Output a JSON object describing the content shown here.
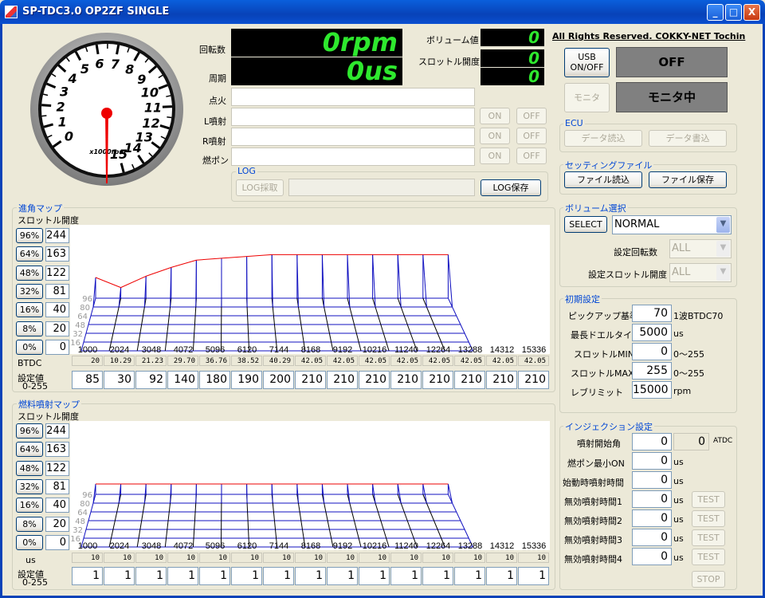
{
  "window": {
    "title": "SP-TDC3.0 OP2ZF SINGLE",
    "min": "_",
    "max": "□",
    "close": "X"
  },
  "copyright": "All Rights Reserved. COKKY-NET Tochin",
  "gauge": {
    "unit_label": "x1000rpm",
    "ticks": [
      "0",
      "1",
      "2",
      "3",
      "4",
      "5",
      "6",
      "7",
      "8",
      "9",
      "10",
      "11",
      "12",
      "13",
      "14",
      "15"
    ]
  },
  "readout": {
    "rpm_label": "回転数",
    "rpm_value": "0rpm",
    "period_label": "周期",
    "period_value": "0us",
    "volume_label": "ボリューム値",
    "volume_value": "0",
    "throttle_label": "スロットル開度",
    "throttle_value": "0",
    "throttle_value2": "0"
  },
  "status_rows": [
    {
      "label": "点火",
      "value": "",
      "has_buttons": false
    },
    {
      "label": "L噴射",
      "value": "",
      "has_buttons": true,
      "on": "ON",
      "off": "OFF"
    },
    {
      "label": "R噴射",
      "value": "",
      "has_buttons": true,
      "on": "ON",
      "off": "OFF"
    },
    {
      "label": "燃ポン",
      "value": "",
      "has_buttons": true,
      "on": "ON",
      "off": "OFF"
    }
  ],
  "log": {
    "title": "LOG",
    "capture": "LOG採取",
    "path": "",
    "save": "LOG保存"
  },
  "usb": {
    "button": "USB\nON/OFF",
    "status": "OFF"
  },
  "monitor": {
    "button": "モニタ",
    "status": "モニタ中"
  },
  "ecu": {
    "title": "ECU",
    "read": "データ読込",
    "write": "データ書込"
  },
  "settings_file": {
    "title": "セッティングファイル",
    "read": "ファイル読込",
    "save": "ファイル保存"
  },
  "volume_select": {
    "title": "ボリューム選択",
    "select_btn": "SELECT",
    "selected": "NORMAL",
    "rpm_label": "設定回転数",
    "rpm_value": "ALL",
    "thr_label": "設定スロットル開度",
    "thr_value": "ALL"
  },
  "init": {
    "title": "初期設定",
    "rows": [
      {
        "label": "ピックアップ基準",
        "value": "70",
        "unit": "1波BTDC70"
      },
      {
        "label": "最長ドエルタイム",
        "value": "5000",
        "unit": "us"
      },
      {
        "label": "スロットルMIN",
        "value": "0",
        "unit": "0～255"
      },
      {
        "label": "スロットルMAX",
        "value": "255",
        "unit": "0～255"
      },
      {
        "label": "レブリミット",
        "value": "15000",
        "unit": "rpm"
      }
    ]
  },
  "injection": {
    "title": "インジェクション設定",
    "start_label": "噴射開始角",
    "start_value": "0",
    "start_value2": "0",
    "start_unit": "ATDC",
    "rows": [
      {
        "label": "燃ポン最小ON",
        "value": "0",
        "unit": "us",
        "test": ""
      },
      {
        "label": "始動時噴射時間",
        "value": "0",
        "unit": "us",
        "test": ""
      },
      {
        "label": "無効噴射時間1",
        "value": "0",
        "unit": "us",
        "test": "TEST"
      },
      {
        "label": "無効噴射時間2",
        "value": "0",
        "unit": "us",
        "test": "TEST"
      },
      {
        "label": "無効噴射時間3",
        "value": "0",
        "unit": "us",
        "test": "TEST"
      },
      {
        "label": "無効噴射時間4",
        "value": "0",
        "unit": "us",
        "test": "TEST"
      }
    ],
    "stop": "STOP"
  },
  "advance_map": {
    "title": "進角マップ",
    "subtitle": "スロットル開度",
    "throttle_rows": [
      {
        "pct": "96%",
        "val": "244"
      },
      {
        "pct": "64%",
        "val": "163"
      },
      {
        "pct": "48%",
        "val": "122"
      },
      {
        "pct": "32%",
        "val": "81"
      },
      {
        "pct": "16%",
        "val": "40"
      },
      {
        "pct": "8%",
        "val": "20"
      },
      {
        "pct": "0%",
        "val": "0"
      }
    ],
    "depth_labels": [
      "96",
      "80",
      "64",
      "48",
      "32",
      "16"
    ],
    "row_label": "BTDC",
    "setting_label": "設定値",
    "setting_range": "0-255",
    "btdc": [
      "20",
      "10.29",
      "21.23",
      "29.70",
      "36.76",
      "38.52",
      "40.29",
      "42.05",
      "42.05",
      "42.05",
      "42.05",
      "42.05",
      "42.05",
      "42.05",
      "42.05"
    ],
    "settings": [
      "85",
      "30",
      "92",
      "140",
      "180",
      "190",
      "200",
      "210",
      "210",
      "210",
      "210",
      "210",
      "210",
      "210",
      "210"
    ]
  },
  "fuel_map": {
    "title": "燃料噴射マップ",
    "subtitle": "スロットル開度",
    "throttle_rows": [
      {
        "pct": "96%",
        "val": "244"
      },
      {
        "pct": "64%",
        "val": "163"
      },
      {
        "pct": "48%",
        "val": "122"
      },
      {
        "pct": "32%",
        "val": "81"
      },
      {
        "pct": "16%",
        "val": "40"
      },
      {
        "pct": "8%",
        "val": "20"
      },
      {
        "pct": "0%",
        "val": "0"
      }
    ],
    "depth_labels": [
      "96",
      "80",
      "64",
      "48",
      "32",
      "16"
    ],
    "row_label": "us",
    "setting_label": "設定値",
    "setting_range": "0-255",
    "us": [
      "10",
      "10",
      "10",
      "10",
      "10",
      "10",
      "10",
      "10",
      "10",
      "10",
      "10",
      "10",
      "10",
      "10",
      "10"
    ],
    "settings": [
      "1",
      "1",
      "1",
      "1",
      "1",
      "1",
      "1",
      "1",
      "1",
      "1",
      "1",
      "1",
      "1",
      "1",
      "1"
    ]
  },
  "chart_data": [
    {
      "type": "area",
      "name": "advance-map",
      "x": [
        1000,
        2024,
        3048,
        4072,
        5096,
        6120,
        7144,
        8168,
        9192,
        10216,
        11240,
        12264,
        13288,
        14312,
        15336
      ],
      "values": [
        20,
        10.29,
        21.23,
        29.7,
        36.76,
        38.52,
        40.29,
        42.05,
        42.05,
        42.05,
        42.05,
        42.05,
        42.05,
        42.05,
        42.05
      ],
      "ylabel": "BTDC"
    },
    {
      "type": "area",
      "name": "fuel-map",
      "x": [
        1000,
        2024,
        3048,
        4072,
        5096,
        6120,
        7144,
        8168,
        9192,
        10216,
        11240,
        12264,
        13288,
        14312,
        15336
      ],
      "values": [
        10,
        10,
        10,
        10,
        10,
        10,
        10,
        10,
        10,
        10,
        10,
        10,
        10,
        10,
        10
      ],
      "ylabel": "us"
    }
  ]
}
